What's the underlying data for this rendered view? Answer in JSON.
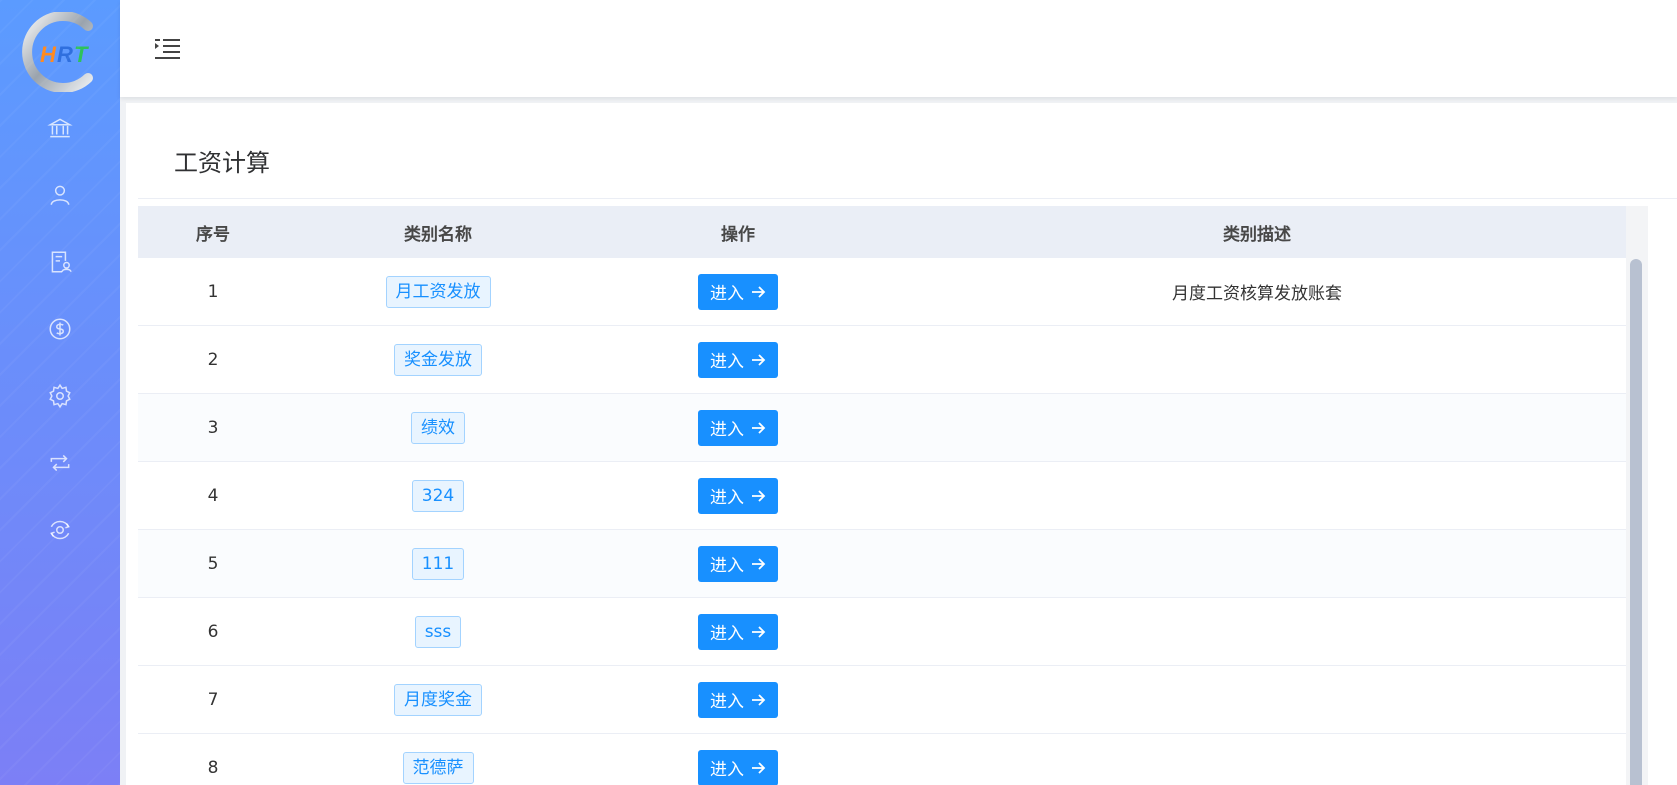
{
  "sidebar": {
    "logo_text": "HRT",
    "items": [
      {
        "icon": "bank-icon"
      },
      {
        "icon": "user-icon"
      },
      {
        "icon": "document-user-icon"
      },
      {
        "icon": "dollar-icon"
      },
      {
        "icon": "gear-icon"
      },
      {
        "icon": "repeat-icon"
      },
      {
        "icon": "eye-refresh-icon"
      }
    ]
  },
  "navbar": {
    "menu_icon": "indent-menu-icon"
  },
  "page": {
    "title": "工资计算"
  },
  "table": {
    "columns": [
      "序号",
      "类别名称",
      "操作",
      "类别描述"
    ],
    "rows": [
      {
        "index": "1",
        "name": "月工资发放",
        "action": "进入",
        "description": "月度工资核算发放账套"
      },
      {
        "index": "2",
        "name": "奖金发放",
        "action": "进入",
        "description": ""
      },
      {
        "index": "3",
        "name": "绩效",
        "action": "进入",
        "description": ""
      },
      {
        "index": "4",
        "name": "324",
        "action": "进入",
        "description": ""
      },
      {
        "index": "5",
        "name": "111",
        "action": "进入",
        "description": ""
      },
      {
        "index": "6",
        "name": "sss",
        "action": "进入",
        "description": ""
      },
      {
        "index": "7",
        "name": "月度奖金",
        "action": "进入",
        "description": ""
      },
      {
        "index": "8",
        "name": "范德萨",
        "action": "进入",
        "description": ""
      }
    ]
  },
  "colors": {
    "primary": "#1890ff",
    "sidebar_top": "#5b9bff",
    "sidebar_bottom": "#7c7ff6",
    "header_bg": "#eaeef6"
  }
}
